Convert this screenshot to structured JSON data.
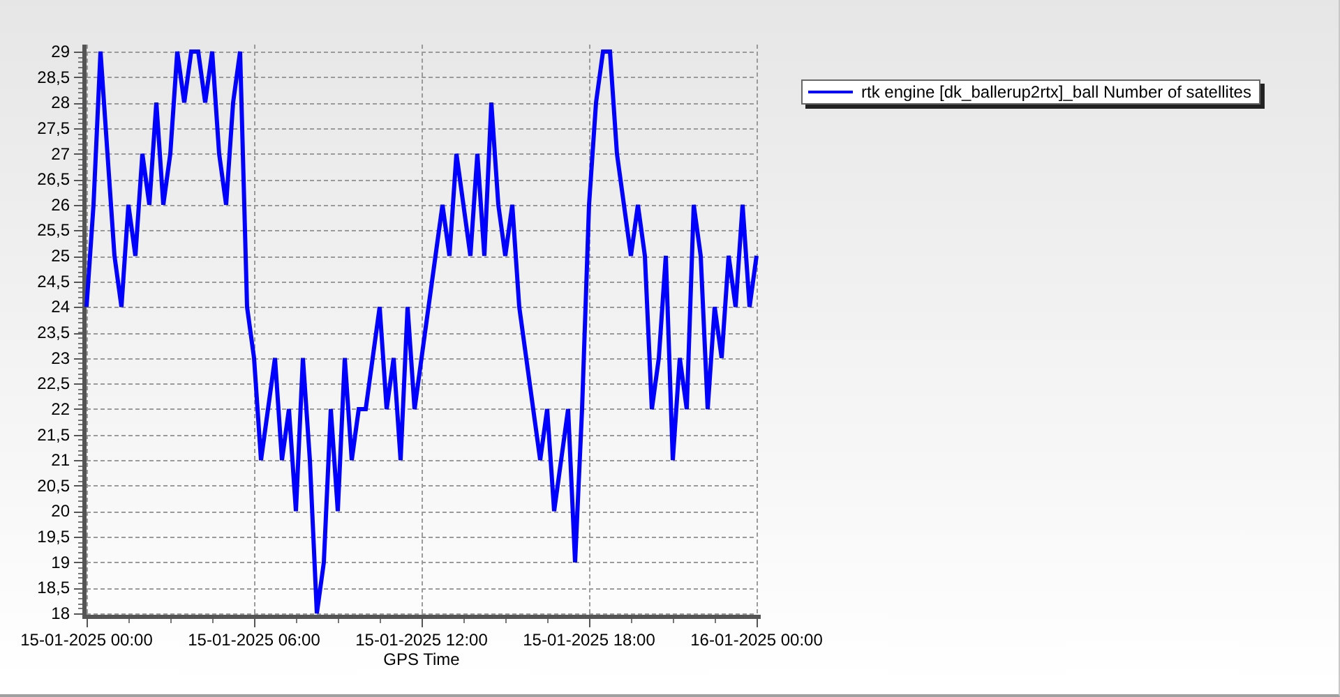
{
  "chart_data": {
    "type": "line",
    "xlabel": "GPS Time",
    "grid": true,
    "ylim": [
      18,
      29
    ],
    "yticks": [
      {
        "value": 18,
        "label": "18"
      },
      {
        "value": 18.5,
        "label": "18,5"
      },
      {
        "value": 19,
        "label": "19"
      },
      {
        "value": 19.5,
        "label": "19,5"
      },
      {
        "value": 20,
        "label": "20"
      },
      {
        "value": 20.5,
        "label": "20,5"
      },
      {
        "value": 21,
        "label": "21"
      },
      {
        "value": 21.5,
        "label": "21,5"
      },
      {
        "value": 22,
        "label": "22"
      },
      {
        "value": 22.5,
        "label": "22,5"
      },
      {
        "value": 23,
        "label": "23"
      },
      {
        "value": 23.5,
        "label": "23,5"
      },
      {
        "value": 24,
        "label": "24"
      },
      {
        "value": 24.5,
        "label": "24,5"
      },
      {
        "value": 25,
        "label": "25"
      },
      {
        "value": 25.5,
        "label": "25,5"
      },
      {
        "value": 26,
        "label": "26"
      },
      {
        "value": 26.5,
        "label": "26,5"
      },
      {
        "value": 27,
        "label": "27"
      },
      {
        "value": 27.5,
        "label": "27,5"
      },
      {
        "value": 28,
        "label": "28"
      },
      {
        "value": 28.5,
        "label": "28,5"
      },
      {
        "value": 29,
        "label": "29"
      }
    ],
    "categories": [
      "15-01-2025 00:00",
      null,
      null,
      null,
      null,
      null,
      null,
      null,
      null,
      null,
      null,
      null,
      null,
      null,
      null,
      null,
      null,
      null,
      null,
      null,
      null,
      null,
      null,
      null,
      "15-01-2025 06:00",
      null,
      null,
      null,
      null,
      null,
      null,
      null,
      null,
      null,
      null,
      null,
      null,
      null,
      null,
      null,
      null,
      null,
      null,
      null,
      null,
      null,
      null,
      null,
      "15-01-2025 12:00",
      null,
      null,
      null,
      null,
      null,
      null,
      null,
      null,
      null,
      null,
      null,
      null,
      null,
      null,
      null,
      null,
      null,
      null,
      null,
      null,
      null,
      null,
      null,
      "15-01-2025 18:00",
      null,
      null,
      null,
      null,
      null,
      null,
      null,
      null,
      null,
      null,
      null,
      null,
      null,
      null,
      null,
      null,
      null,
      null,
      null,
      null,
      null,
      null,
      null,
      "16-01-2025 00:00"
    ],
    "series": [
      {
        "name": "rtk engine [dk_ballerup2rtx]_ball Number of satellites",
        "color": "#0000ff",
        "values": [
          24,
          26,
          29,
          27,
          25,
          24,
          26,
          25,
          27,
          26,
          28,
          26,
          27,
          29,
          28,
          29,
          29,
          28,
          29,
          27,
          26,
          28,
          29,
          24,
          23,
          21,
          22,
          23,
          21,
          22,
          20,
          23,
          21,
          18,
          19,
          22,
          20,
          23,
          21,
          22,
          22,
          23,
          24,
          22,
          23,
          21,
          24,
          22,
          23,
          24,
          25,
          26,
          25,
          27,
          26,
          25,
          27,
          25,
          28,
          26,
          25,
          26,
          24,
          23,
          22,
          21,
          22,
          20,
          21,
          22,
          19,
          22,
          26,
          28,
          29,
          29,
          27,
          26,
          25,
          26,
          25,
          22,
          23,
          25,
          21,
          23,
          22,
          26,
          25,
          22,
          24,
          23,
          25,
          24,
          26,
          24,
          25
        ]
      }
    ]
  }
}
